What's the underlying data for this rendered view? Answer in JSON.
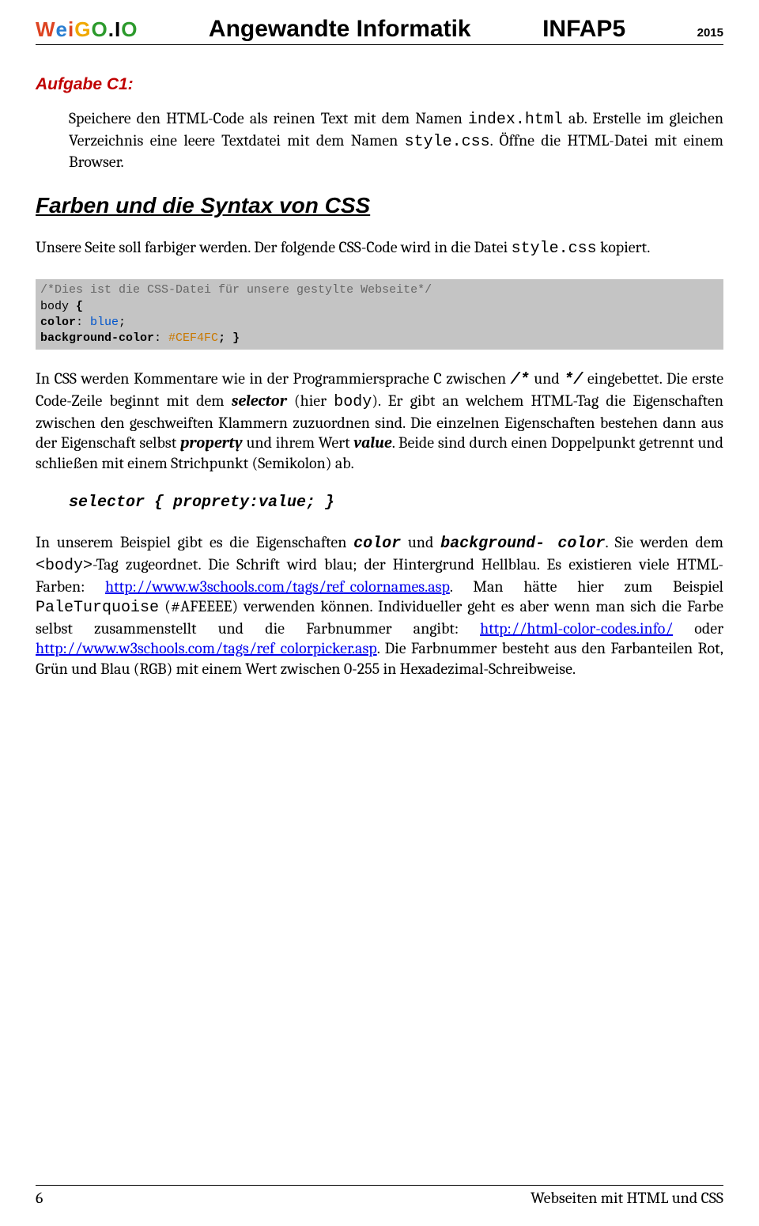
{
  "header": {
    "logo_letters": [
      "W",
      "e",
      "i",
      "G",
      "O",
      ".",
      "I",
      "O"
    ],
    "title1": "Angewandte Informatik",
    "title2": "INFAP5",
    "year": "2015"
  },
  "aufgabe": {
    "heading": "Aufgabe C1:",
    "p1_a": "Speichere den HTML-Code als reinen Text mit dem Namen ",
    "p1_code1": "index.html",
    "p1_b": " ab. Erstelle im gleichen Verzeichnis eine leere Textdatei mit dem Namen ",
    "p1_code2": "style.css",
    "p1_c": ". Öffne die HTML-Datei mit einem Browser."
  },
  "section": {
    "h2": "Farben und die Syntax von CSS",
    "p1_a": "Unsere Seite soll farbiger werden. Der folgende CSS-Code wird in die Datei ",
    "p1_code": "style.css",
    "p1_b": " kopiert.",
    "code": {
      "comment": "/*Dies ist die CSS-Datei für unsere gestylte Webseite*/",
      "sel": "body",
      "brace_o": " {",
      "prop1": "  color",
      "colon": ": ",
      "val1": "blue",
      "semi": ";",
      "prop2": "  background-color",
      "val2": "#CEF4FC",
      "brace_c": "; }"
    },
    "p2_a": "In CSS werden Kommentare wie in der Programmiersprache C zwischen ",
    "p2_c1": "/*",
    "p2_b": " und ",
    "p2_c2": "*/",
    "p2_c": " eingebettet. Die erste Code-Zeile beginnt mit dem ",
    "p2_sel": "selector",
    "p2_d": " (hier ",
    "p2_body": "body",
    "p2_e": "). Er gibt an welchem HTML-Tag die Eigenschaften zwischen den geschweiften Klammern zuzuordnen sind. Die einzelnen Eigenschaften bestehen dann aus der Eigenschaft selbst ",
    "p2_prop": "property",
    "p2_f": " und ihrem Wert ",
    "p2_val": "value",
    "p2_g": ". Beide sind durch einen Doppelpunkt getrennt und schließen mit einem Strichpunkt (Semikolon) ab.",
    "syntax": "selector { proprety:value; }",
    "p3_a": "In unserem Beispiel gibt es die Eigenschaften ",
    "p3_color": "color",
    "p3_b": " und ",
    "p3_bg": "background- color",
    "p3_c": ". Sie werden dem ",
    "p3_body": "<body>",
    "p3_d": "-Tag zugeordnet. Die Schrift wird blau; der Hintergrund Hellblau. Es existieren viele HTML-Farben: ",
    "p3_link1": "http://www.w3schools.com/tags/ref_colornames.asp",
    "p3_e": ". Man hätte hier zum Beispiel ",
    "p3_pt": "PaleTurquoise",
    "p3_f": " (#AFEEEE) verwenden können. Individueller geht es aber wenn man sich die Farbe selbst zusammenstellt und die Farbnummer angibt: ",
    "p3_link2": "http://html-color-codes.info/",
    "p3_g": " oder ",
    "p3_link3": "http://www.w3schools.com/tags/ref_colorpicker.asp",
    "p3_h": ". Die Farbnummer besteht aus den Farbanteilen Rot, Grün und Blau (RGB) mit einem Wert zwischen 0-255 in Hexadezimal-Schreibweise."
  },
  "footer": {
    "page": "6",
    "title": "Webseiten mit HTML und CSS"
  }
}
